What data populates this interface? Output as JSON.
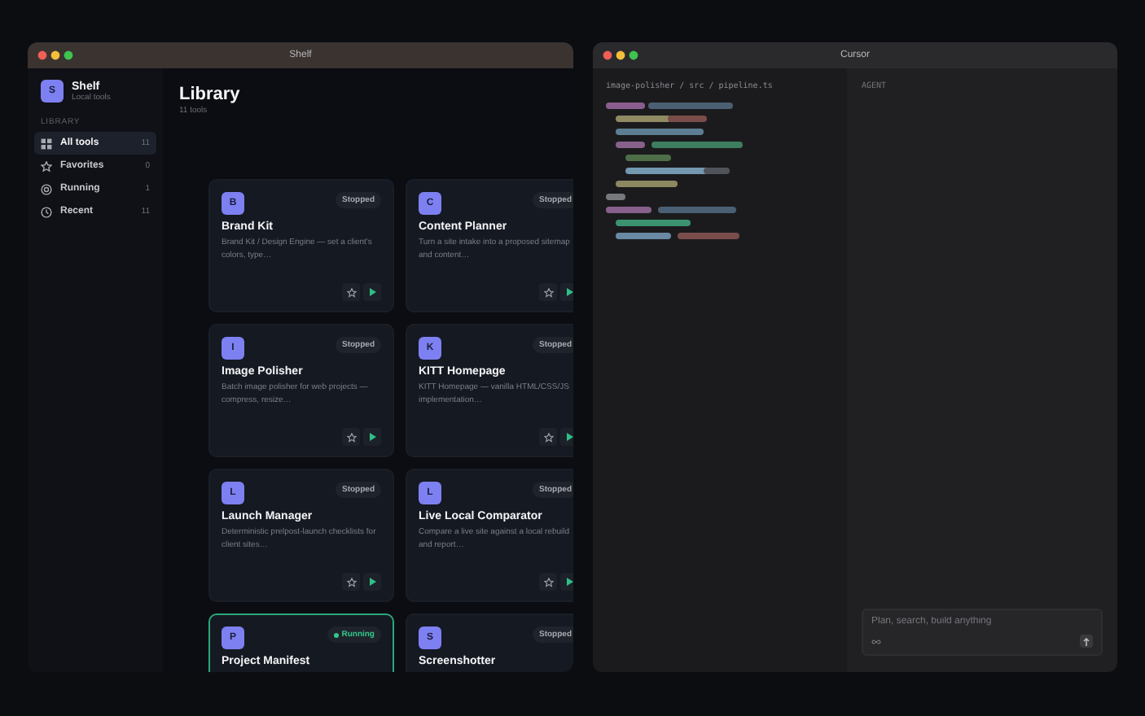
{
  "shelf_window": {
    "title": "Shelf"
  },
  "sidebar": {
    "app_name": "Shelf",
    "app_subtitle": "Local tools",
    "avatar": "S",
    "section": "LIBRARY",
    "items": [
      {
        "label": "All tools",
        "count": "11",
        "selected": true,
        "kind": "grid"
      },
      {
        "label": "Favorites",
        "count": "0",
        "selected": false,
        "kind": "star"
      },
      {
        "label": "Running",
        "count": "1",
        "selected": false,
        "kind": "running"
      },
      {
        "label": "Recent",
        "count": "11",
        "selected": false,
        "kind": "recent"
      }
    ]
  },
  "library": {
    "title": "Library",
    "subtitle": "11 tools",
    "cards": [
      {
        "letter": "B",
        "name": "Brand Kit",
        "description": "Brand Kit / Design Engine — set a client's colors, type…",
        "status": "Stopped",
        "running": false
      },
      {
        "letter": "C",
        "name": "Content Planner",
        "description": "Turn a site intake into a proposed sitemap and content…",
        "status": "Stopped",
        "running": false
      },
      {
        "letter": "I",
        "name": "Image Polisher",
        "description": "Batch image polisher for web projects — compress, resize…",
        "status": "Stopped",
        "running": false
      },
      {
        "letter": "K",
        "name": "KITT Homepage",
        "description": "KITT Homepage — vanilla HTML/CSS/JS implementation…",
        "status": "Stopped",
        "running": false
      },
      {
        "letter": "L",
        "name": "Launch Manager",
        "description": "Deterministic prelpost-launch checklists for client sites…",
        "status": "Stopped",
        "running": false
      },
      {
        "letter": "L",
        "name": "Live Local Comparator",
        "description": "Compare a live site against a local rebuild and report…",
        "status": "Stopped",
        "running": false
      },
      {
        "letter": "P",
        "name": "Project Manifest",
        "status": "Running",
        "running": true
      },
      {
        "letter": "S",
        "name": "Screenshotter",
        "status": "Stopped",
        "running": false
      }
    ]
  },
  "cursor_window": {
    "title": "Cursor",
    "breadcrumb": "image-polisher / src / pipeline.ts",
    "agent_label": "AGENT",
    "prompt": {
      "placeholder": "Plan, search, build anything"
    }
  }
}
